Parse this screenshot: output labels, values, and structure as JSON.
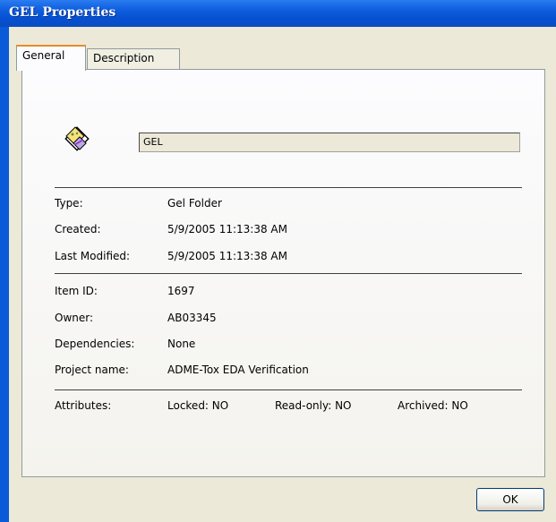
{
  "window": {
    "title": "GEL Properties"
  },
  "tabs": [
    {
      "label": "General",
      "active": true
    },
    {
      "label": "Description",
      "active": false
    }
  ],
  "item": {
    "icon": "gel-folder-icon",
    "name": "GEL"
  },
  "details": {
    "type": {
      "label": "Type:",
      "value": "Gel Folder"
    },
    "created": {
      "label": "Created:",
      "value": "5/9/2005 11:13:38 AM"
    },
    "modified": {
      "label": "Last Modified:",
      "value": "5/9/2005 11:13:38 AM"
    },
    "item_id": {
      "label": "Item ID:",
      "value": "1697"
    },
    "owner": {
      "label": "Owner:",
      "value": "AB03345"
    },
    "dependencies": {
      "label": "Dependencies:",
      "value": "None"
    },
    "project": {
      "label": "Project name:",
      "value": "ADME-Tox EDA Verification"
    }
  },
  "attributes": {
    "label": "Attributes:",
    "locked": "Locked: NO",
    "read_only": "Read-only: NO",
    "archived": "Archived: NO"
  },
  "buttons": {
    "ok": "OK"
  }
}
